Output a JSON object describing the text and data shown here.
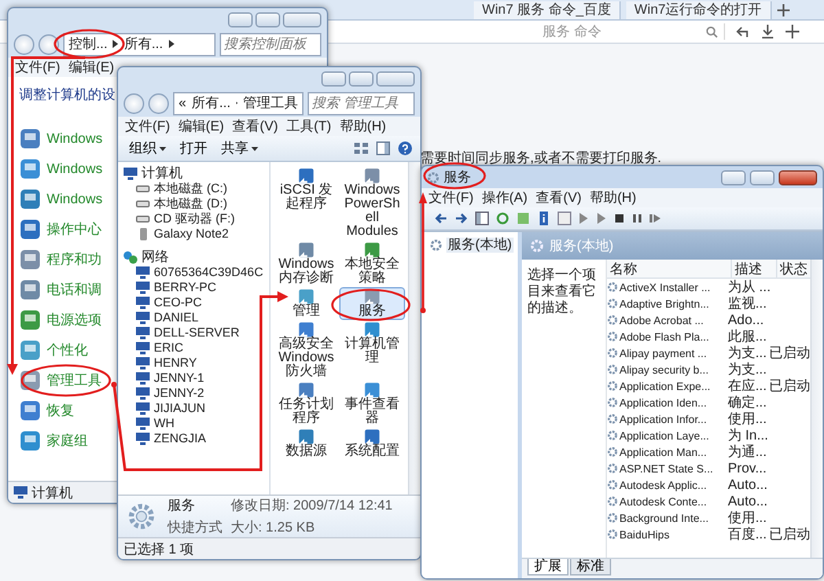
{
  "browser": {
    "tabs": [
      {
        "label": "Win7 服务 命令_百度",
        "selected": false
      },
      {
        "label": "Win7运行命令的打开",
        "selected": false
      }
    ],
    "search": {
      "value": "服务 命令"
    },
    "page_text": "需要时间同步服务,或者不需要打印服务."
  },
  "control_panel": {
    "breadcrumb": [
      "控制...",
      "所有..."
    ],
    "search": {
      "placeholder": "搜索控制面板"
    },
    "menu": [
      "文件(F)",
      "编辑(E)"
    ],
    "heading": "调整计算机的设",
    "items": [
      "Windows",
      "Windows",
      "Windows",
      "操作中心",
      "程序和功",
      "电话和调",
      "电源选项",
      "个性化",
      "管理工具",
      "恢复",
      "家庭组"
    ],
    "status_bar": "计算机"
  },
  "admin_tools": {
    "breadcrumb_prefix": "«",
    "breadcrumb": [
      "所有...",
      "管理工具"
    ],
    "search": {
      "placeholder": "搜索 管理工具"
    },
    "menu": [
      "文件(F)",
      "编辑(E)",
      "查看(V)",
      "工具(T)",
      "帮助(H)"
    ],
    "toolbar": [
      {
        "label": "组织",
        "dropdown": true
      },
      {
        "label": "打开",
        "dropdown": false
      },
      {
        "label": "共享",
        "dropdown": true
      }
    ],
    "nav": [
      {
        "label": "计算机",
        "kind": "computer",
        "children": [
          {
            "label": "本地磁盘 (C:)",
            "kind": "drive"
          },
          {
            "label": "本地磁盘 (D:)",
            "kind": "drive"
          },
          {
            "label": "CD 驱动器 (F:)",
            "kind": "drive"
          },
          {
            "label": "Galaxy Note2",
            "kind": "phone"
          }
        ]
      },
      {
        "label": "网络",
        "kind": "network",
        "children": [
          {
            "label": "60765364C39D46C",
            "kind": "computer"
          },
          {
            "label": "BERRY-PC",
            "kind": "computer"
          },
          {
            "label": "CEO-PC",
            "kind": "computer"
          },
          {
            "label": "DANIEL",
            "kind": "computer"
          },
          {
            "label": "DELL-SERVER",
            "kind": "computer"
          },
          {
            "label": "ERIC",
            "kind": "computer"
          },
          {
            "label": "HENRY",
            "kind": "computer"
          },
          {
            "label": "JENNY-1",
            "kind": "computer"
          },
          {
            "label": "JENNY-2",
            "kind": "computer"
          },
          {
            "label": "JIJIAJUN",
            "kind": "computer"
          },
          {
            "label": "WH",
            "kind": "computer"
          },
          {
            "label": "ZENGJIA",
            "kind": "computer"
          }
        ]
      }
    ],
    "items": [
      {
        "label": "iSCSI 发起程序",
        "selected": false
      },
      {
        "label": "Windows PowerShell Modules",
        "selected": false
      },
      {
        "label": "Windows 内存诊断",
        "selected": false
      },
      {
        "label": "本地安全策略",
        "selected": false
      },
      {
        "label": "管理",
        "selected": false
      },
      {
        "label": "服务",
        "selected": true
      },
      {
        "label": "高级安全 Windows 防火墙",
        "selected": false
      },
      {
        "label": "计算机管理",
        "selected": false
      },
      {
        "label": "任务计划程序",
        "selected": false
      },
      {
        "label": "事件查看器",
        "selected": false
      },
      {
        "label": "数据源",
        "selected": false
      },
      {
        "label": "系统配置",
        "selected": false
      }
    ],
    "details": {
      "name": "服务",
      "modified": "修改日期: 2009/7/14 12:41",
      "type": "快捷方式",
      "size": "大小: 1.25 KB"
    },
    "status_bar": "已选择 1 项"
  },
  "services": {
    "title": "服务",
    "menu": [
      "文件(F)",
      "操作(A)",
      "查看(V)",
      "帮助(H)"
    ],
    "tree_item": "服务(本地)",
    "pane_title": "服务(本地)",
    "description": "选择一个项目来查看它的描述。",
    "columns": [
      "名称",
      "描述",
      "状态"
    ],
    "rows": [
      {
        "name": "ActiveX Installer ...",
        "description": "为从 ..."
      },
      {
        "name": "Adaptive Brightn...",
        "description": "监视..."
      },
      {
        "name": "Adobe Acrobat ...",
        "description": "Ado..."
      },
      {
        "name": "Adobe Flash Pla...",
        "description": "此服..."
      },
      {
        "name": "Alipay payment ...",
        "description": "为支...",
        "status": "已启动"
      },
      {
        "name": "Alipay security b...",
        "description": "为支..."
      },
      {
        "name": "Application Expe...",
        "description": "在应...",
        "status": "已启动"
      },
      {
        "name": "Application Iden...",
        "description": "确定..."
      },
      {
        "name": "Application Infor...",
        "description": "使用..."
      },
      {
        "name": "Application Laye...",
        "description": "为 In..."
      },
      {
        "name": "Application Man...",
        "description": "为通..."
      },
      {
        "name": "ASP.NET State S...",
        "description": "Prov..."
      },
      {
        "name": "Autodesk Applic...",
        "description": "Auto..."
      },
      {
        "name": "Autodesk Conte...",
        "description": "Auto..."
      },
      {
        "name": "Background Inte...",
        "description": "使用..."
      },
      {
        "name": "BaiduHips",
        "description": "百度...",
        "status": "已启动"
      }
    ],
    "tabs": [
      {
        "label": "扩展",
        "selected": true
      },
      {
        "label": "标准",
        "selected": false
      }
    ]
  }
}
